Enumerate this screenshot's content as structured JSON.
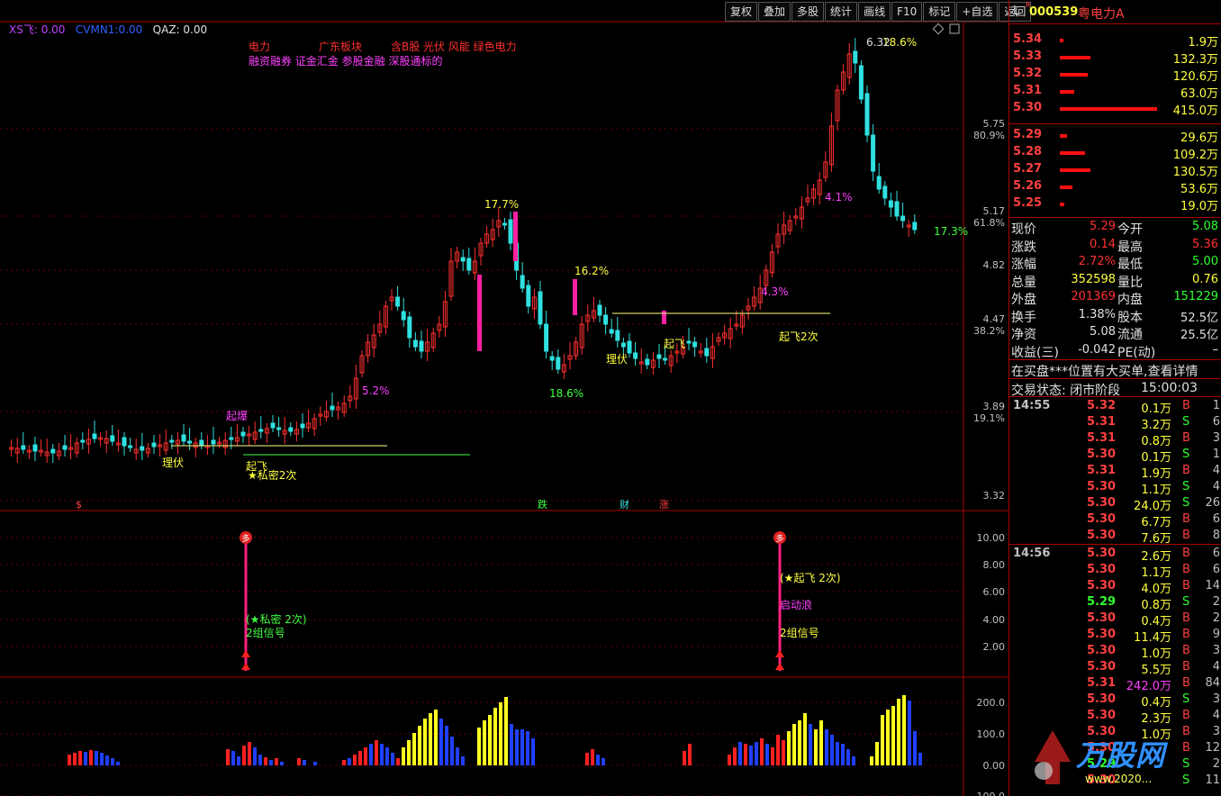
{
  "toolbar": [
    "复权",
    "叠加",
    "多股",
    "统计",
    "画线",
    "F10",
    "标记",
    "+自选",
    "返回"
  ],
  "indicators": {
    "xs_label": "XS飞:",
    "xs_val": "0.00",
    "cvmn_label": "CVMN1:",
    "cvmn_val": "0.00",
    "qaz_label": "QAZ:",
    "qaz_val": "0.00"
  },
  "concepts": {
    "line1": [
      "电力",
      "广东板块",
      "含B股 光伏 风能 绿色电力"
    ],
    "line2": "融资融券 证金汇金 参股金融 深股通标的"
  },
  "price_axis": [
    {
      "v": "5.75",
      "p": "80.9%"
    },
    {
      "v": "5.17",
      "p": "61.8%"
    },
    {
      "v": "4.82",
      "p": ""
    },
    {
      "v": "4.47",
      "p": "38.2%"
    },
    {
      "v": "3.89",
      "p": "19.1%"
    },
    {
      "v": "3.32",
      "p": ""
    }
  ],
  "top_label": "6.32",
  "mid_axis": [
    "10.00",
    "8.00",
    "6.00",
    "4.00",
    "2.00"
  ],
  "vol_axis": [
    "200.0",
    "100.0",
    "0.00",
    "-100.0"
  ],
  "annotations": {
    "a1": "17.7%",
    "a2": "16.2%",
    "a3": "18.6%",
    "a4": "4.1%",
    "a5": "4.3%",
    "a6": "17.3%",
    "a7": "18.6%",
    "a8": "5.2%",
    "liful": "理伏",
    "qifei": "起飞",
    "qifei2": "起飞2次",
    "sm": "★私密2次",
    "qibao": "起爆",
    "die": "跌",
    "cai": "财",
    "zhang": "涨",
    "s": "$",
    "liful2": "理伏",
    "qifei3": "起飞",
    "sig1a": "(★私密 2次)",
    "sig1b": "2组信号",
    "sig2a": "(★起飞 2次)",
    "sig2b": "启动浪",
    "sig2c": "2组信号",
    "duo": "多"
  },
  "stock": {
    "prefix": "L",
    "code": "000539",
    "name": "粤电力A"
  },
  "asks": [
    {
      "p": "5.34",
      "v": "1.9万",
      "w": 4
    },
    {
      "p": "5.33",
      "v": "132.3万",
      "w": 34
    },
    {
      "p": "5.32",
      "v": "120.6万",
      "w": 31
    },
    {
      "p": "5.31",
      "v": "63.0万",
      "w": 16
    },
    {
      "p": "5.30",
      "v": "415.0万",
      "w": 108
    }
  ],
  "bids": [
    {
      "p": "5.29",
      "v": "29.6万",
      "w": 8
    },
    {
      "p": "5.28",
      "v": "109.2万",
      "w": 28
    },
    {
      "p": "5.27",
      "v": "130.5万",
      "w": 34
    },
    {
      "p": "5.26",
      "v": "53.6万",
      "w": 14
    },
    {
      "p": "5.25",
      "v": "19.0万",
      "w": 5
    }
  ],
  "quote": [
    {
      "l1": "现价",
      "v1": "5.29",
      "c1": "#ff3030",
      "l2": "今开",
      "v2": "5.08",
      "c2": "#30ff30"
    },
    {
      "l1": "涨跌",
      "v1": "0.14",
      "c1": "#ff3030",
      "l2": "最高",
      "v2": "5.36",
      "c2": "#ff3030"
    },
    {
      "l1": "涨幅",
      "v1": "2.72%",
      "c1": "#ff3030",
      "l2": "最低",
      "v2": "5.00",
      "c2": "#30ff30"
    },
    {
      "l1": "总量",
      "v1": "352598",
      "c1": "#ffff40",
      "l2": "量比",
      "v2": "0.76",
      "c2": "#ffff40"
    },
    {
      "l1": "外盘",
      "v1": "201369",
      "c1": "#ff3030",
      "l2": "内盘",
      "v2": "151229",
      "c2": "#30ff30"
    },
    {
      "l1": "换手",
      "v1": "1.38%",
      "c1": "#e0e0e0",
      "l2": "股本",
      "v2": "52.5亿",
      "c2": "#e0e0e0"
    },
    {
      "l1": "净资",
      "v1": "5.08",
      "c1": "#e0e0e0",
      "l2": "流通",
      "v2": "25.5亿",
      "c2": "#e0e0e0"
    },
    {
      "l1": "收益(三)",
      "v1": "-0.042",
      "c1": "#e0e0e0",
      "l2": "PE(动)",
      "v2": "–",
      "c2": "#e0e0e0"
    }
  ],
  "notice": "在买盘***位置有大买单,查看详情",
  "trade_status": {
    "label": "交易状态: 闭市阶段",
    "time": "15:00:03"
  },
  "ticks": [
    {
      "t": "14:55",
      "p": "5.32",
      "v": "0.1万",
      "s": "B",
      "n": "1"
    },
    {
      "t": "",
      "p": "5.31",
      "v": "3.2万",
      "s": "S",
      "n": "6"
    },
    {
      "t": "",
      "p": "5.31",
      "v": "0.8万",
      "s": "B",
      "n": "3"
    },
    {
      "t": "",
      "p": "5.30",
      "v": "0.1万",
      "s": "S",
      "n": "1"
    },
    {
      "t": "",
      "p": "5.31",
      "v": "1.9万",
      "s": "B",
      "n": "4"
    },
    {
      "t": "",
      "p": "5.30",
      "v": "1.1万",
      "s": "S",
      "n": "4"
    },
    {
      "t": "",
      "p": "5.30",
      "v": "24.0万",
      "s": "S",
      "n": "26"
    },
    {
      "t": "",
      "p": "5.30",
      "v": "6.7万",
      "s": "B",
      "n": "6"
    },
    {
      "t": "",
      "p": "5.30",
      "v": "7.6万",
      "s": "B",
      "n": "8"
    },
    {
      "t": "14:56",
      "p": "5.30",
      "v": "2.6万",
      "s": "B",
      "n": "6"
    },
    {
      "t": "",
      "p": "5.30",
      "v": "1.1万",
      "s": "B",
      "n": "6"
    },
    {
      "t": "",
      "p": "5.30",
      "v": "4.0万",
      "s": "B",
      "n": "14"
    },
    {
      "t": "",
      "p": "5.29",
      "v": "0.8万",
      "s": "S",
      "n": "2"
    },
    {
      "t": "",
      "p": "5.30",
      "v": "0.4万",
      "s": "B",
      "n": "2"
    },
    {
      "t": "",
      "p": "5.30",
      "v": "11.4万",
      "s": "B",
      "n": "9"
    },
    {
      "t": "",
      "p": "5.30",
      "v": "1.0万",
      "s": "B",
      "n": "3"
    },
    {
      "t": "",
      "p": "5.30",
      "v": "5.5万",
      "s": "B",
      "n": "4"
    },
    {
      "t": "",
      "p": "5.31",
      "v": "242.0万",
      "s": "B",
      "n": "84"
    },
    {
      "t": "",
      "p": "5.30",
      "v": "0.4万",
      "s": "S",
      "n": "3"
    },
    {
      "t": "",
      "p": "5.30",
      "v": "2.3万",
      "s": "B",
      "n": "4"
    },
    {
      "t": "",
      "p": "5.30",
      "v": "1.0万",
      "s": "B",
      "n": "3"
    },
    {
      "t": "",
      "p": "5.30",
      "v": "",
      "s": "B",
      "n": "12"
    },
    {
      "t": "",
      "p": "5.29",
      "v": "",
      "s": "S",
      "n": "2"
    },
    {
      "t": "",
      "p": "5.30",
      "v": "",
      "s": "S",
      "n": "11"
    }
  ],
  "watermark": "万股网",
  "watermark_url": "www.2020..."
}
